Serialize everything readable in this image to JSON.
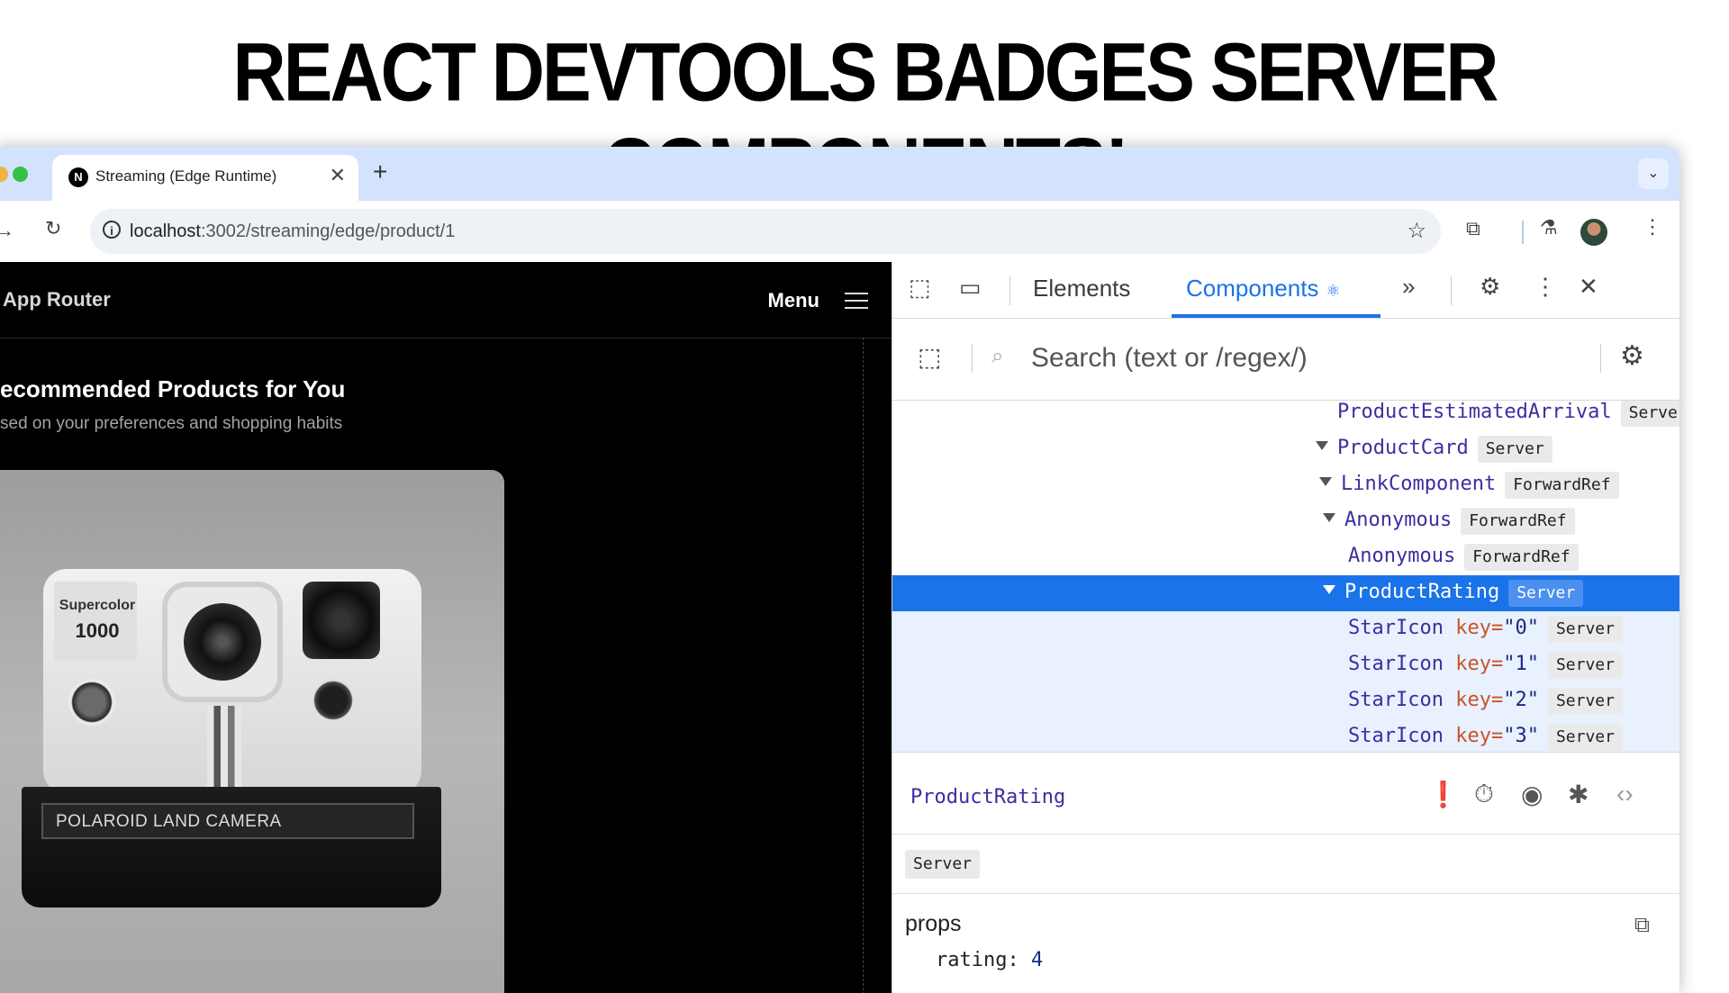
{
  "headline": "REACT DEVTOOLS BADGES SERVER COMPONENTS!",
  "browser": {
    "tab_title": "Streaming (Edge Runtime)",
    "tab_favicon": "N",
    "new_tab_icon": "plus-icon",
    "url_host": "localhost",
    "url_rest": ":3002/streaming/edge/product/1"
  },
  "page": {
    "app_title": "App Router",
    "menu_label": "Menu",
    "heading": "ecommended Products for You",
    "subheading": "sed on your preferences and shopping habits",
    "product": {
      "brand": "Supercolor",
      "model": "1000",
      "plate": "POLAROID LAND CAMERA"
    }
  },
  "devtools": {
    "tabs": [
      "Elements",
      "Components"
    ],
    "search_placeholder": "Search (text or /regex/)",
    "tree": [
      {
        "name": "ProductEstimatedArrival",
        "badge": "Server",
        "indent": 0,
        "caret": false,
        "partial": true
      },
      {
        "name": "ProductCard",
        "badge": "Server",
        "indent": 0,
        "caret": true
      },
      {
        "name": "LinkComponent",
        "badge": "ForwardRef",
        "indent": 1,
        "caret": true
      },
      {
        "name": "Anonymous",
        "badge": "ForwardRef",
        "indent": 2,
        "caret": true
      },
      {
        "name": "Anonymous",
        "badge": "ForwardRef",
        "indent": 3,
        "caret": false
      },
      {
        "name": "ProductRating",
        "badge": "Server",
        "indent": 2,
        "caret": true,
        "selected": true
      },
      {
        "name": "StarIcon",
        "key": "0",
        "badge": "Server",
        "indent": 3,
        "caret": false,
        "child": true
      },
      {
        "name": "StarIcon",
        "key": "1",
        "badge": "Server",
        "indent": 3,
        "caret": false,
        "child": true
      },
      {
        "name": "StarIcon",
        "key": "2",
        "badge": "Server",
        "indent": 3,
        "caret": false,
        "child": true
      },
      {
        "name": "StarIcon",
        "key": "3",
        "badge": "Server",
        "indent": 3,
        "caret": false,
        "child": true
      }
    ],
    "key_label": "key=",
    "inspector": {
      "component_name": "ProductRating",
      "badge": "Server",
      "props_label": "props",
      "props": [
        {
          "name": "rating",
          "value": "4"
        }
      ]
    }
  }
}
